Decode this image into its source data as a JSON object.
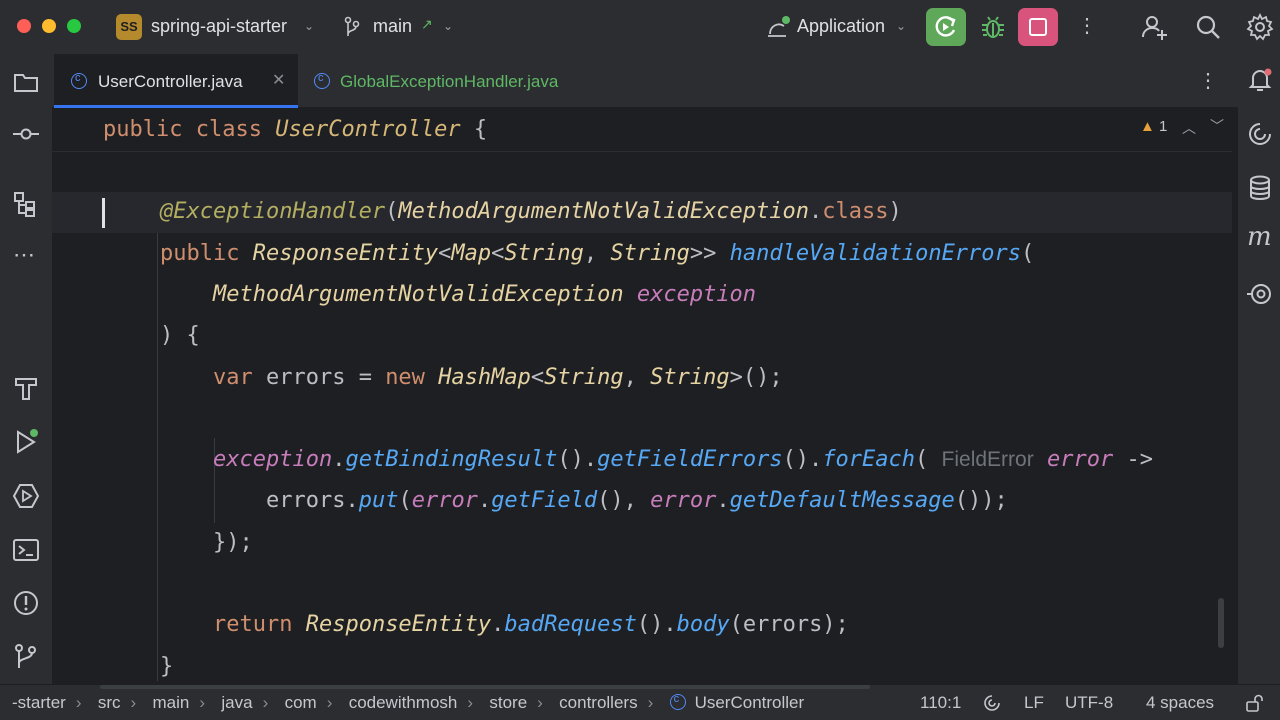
{
  "titlebar": {
    "project_badge": "SS",
    "project_name": "spring-api-starter",
    "branch": "main",
    "branch_arrow": "↗",
    "run_config": "Application"
  },
  "tabs": [
    {
      "label": "UserController.java",
      "active": true,
      "color": "#548af7"
    },
    {
      "label": "GlobalExceptionHandler.java",
      "active": false,
      "color": "#5fb865"
    }
  ],
  "editor": {
    "warning_count": "1",
    "sticky_header": [
      {
        "t": "public",
        "c": "kw"
      },
      {
        "t": " "
      },
      {
        "t": "class",
        "c": "kw"
      },
      {
        "t": " "
      },
      {
        "t": "UserController",
        "c": "tyn"
      },
      {
        "t": " {",
        "c": "pu"
      }
    ],
    "lines": [
      [],
      [
        {
          "t": "@ExceptionHandler",
          "c": "an"
        },
        {
          "t": "(",
          "c": "pu"
        },
        {
          "t": "MethodArgumentNotValidException",
          "c": "ty"
        },
        {
          "t": ".",
          "c": "pu"
        },
        {
          "t": "class",
          "c": "kw"
        },
        {
          "t": ")",
          "c": "pu"
        }
      ],
      [
        {
          "t": "public",
          "c": "kw"
        },
        {
          "t": " "
        },
        {
          "t": "ResponseEntity",
          "c": "ty"
        },
        {
          "t": "<",
          "c": "pu"
        },
        {
          "t": "Map",
          "c": "ty"
        },
        {
          "t": "<",
          "c": "pu"
        },
        {
          "t": "String",
          "c": "ty"
        },
        {
          "t": ", ",
          "c": "pu"
        },
        {
          "t": "String",
          "c": "ty"
        },
        {
          "t": ">> ",
          "c": "pu"
        },
        {
          "t": "handleValidationErrors",
          "c": "fn"
        },
        {
          "t": "(",
          "c": "pu"
        }
      ],
      [
        {
          "t": "    "
        },
        {
          "t": "MethodArgumentNotValidException",
          "c": "ty"
        },
        {
          "t": " "
        },
        {
          "t": "exception",
          "c": "pa"
        }
      ],
      [
        {
          "t": ") {",
          "c": "pu"
        }
      ],
      [
        {
          "t": "    "
        },
        {
          "t": "var",
          "c": "kw"
        },
        {
          "t": " errors = ",
          "c": "vr"
        },
        {
          "t": "new",
          "c": "kw"
        },
        {
          "t": " "
        },
        {
          "t": "HashMap",
          "c": "ty"
        },
        {
          "t": "<",
          "c": "pu"
        },
        {
          "t": "String",
          "c": "ty"
        },
        {
          "t": ", ",
          "c": "pu"
        },
        {
          "t": "String",
          "c": "ty"
        },
        {
          "t": ">();",
          "c": "pu"
        }
      ],
      [],
      [
        {
          "t": "    "
        },
        {
          "t": "exception",
          "c": "pa"
        },
        {
          "t": ".",
          "c": "pu"
        },
        {
          "t": "getBindingResult",
          "c": "fn"
        },
        {
          "t": "().",
          "c": "pu"
        },
        {
          "t": "getFieldErrors",
          "c": "fn"
        },
        {
          "t": "().",
          "c": "pu"
        },
        {
          "t": "forEach",
          "c": "fn"
        },
        {
          "t": "( ",
          "c": "pu"
        },
        {
          "t": "FieldError",
          "c": "hint"
        },
        {
          "t": " "
        },
        {
          "t": "error",
          "c": "pa"
        },
        {
          "t": " ->",
          "c": "pu"
        }
      ],
      [
        {
          "t": "        "
        },
        {
          "t": "errors",
          "c": "vr"
        },
        {
          "t": ".",
          "c": "pu"
        },
        {
          "t": "put",
          "c": "fn"
        },
        {
          "t": "(",
          "c": "pu"
        },
        {
          "t": "error",
          "c": "pa"
        },
        {
          "t": ".",
          "c": "pu"
        },
        {
          "t": "getField",
          "c": "fn"
        },
        {
          "t": "(), ",
          "c": "pu"
        },
        {
          "t": "error",
          "c": "pa"
        },
        {
          "t": ".",
          "c": "pu"
        },
        {
          "t": "getDefaultMessage",
          "c": "fn"
        },
        {
          "t": "());",
          "c": "pu"
        }
      ],
      [
        {
          "t": "    "
        },
        {
          "t": "});",
          "c": "pu"
        }
      ],
      [],
      [
        {
          "t": "    "
        },
        {
          "t": "return",
          "c": "kw"
        },
        {
          "t": " "
        },
        {
          "t": "ResponseEntity",
          "c": "ty"
        },
        {
          "t": ".",
          "c": "pu"
        },
        {
          "t": "badRequest",
          "c": "fn"
        },
        {
          "t": "().",
          "c": "pu"
        },
        {
          "t": "body",
          "c": "fn"
        },
        {
          "t": "(errors);",
          "c": "pu"
        }
      ],
      [
        {
          "t": "}",
          "c": "pu"
        }
      ]
    ]
  },
  "statusbar": {
    "breadcrumbs": [
      "-starter",
      "src",
      "main",
      "java",
      "com",
      "codewithmosh",
      "store",
      "controllers",
      "UserController"
    ],
    "position": "110:1",
    "line_ending": "LF",
    "encoding": "UTF-8",
    "indent": "4 spaces"
  }
}
